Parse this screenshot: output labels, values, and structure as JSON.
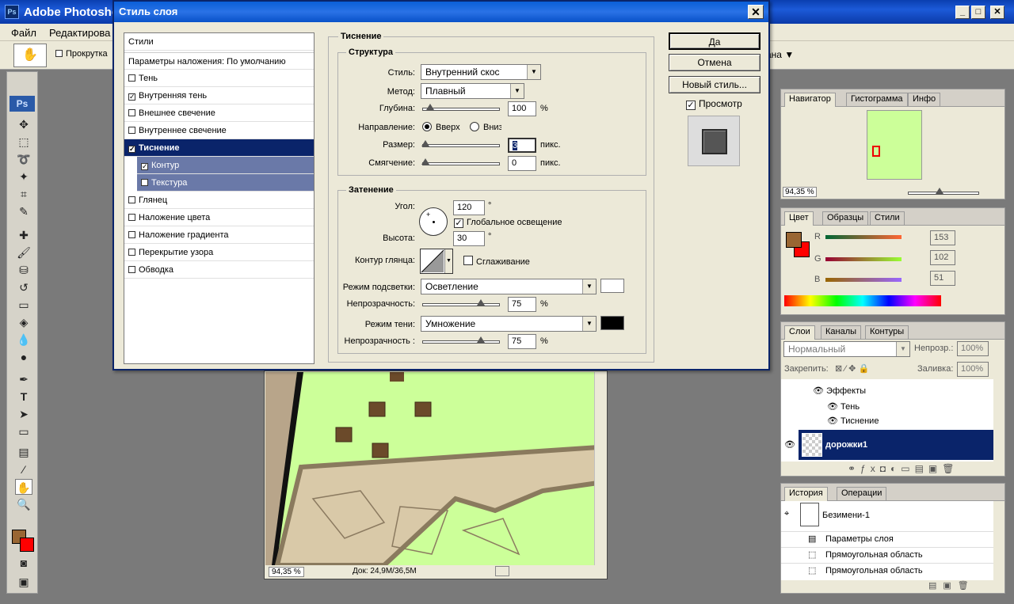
{
  "app": {
    "title": "Adobe Photosho",
    "logo": "Ps"
  },
  "menu": [
    "Файл",
    "Редактирова"
  ],
  "options": {
    "scroll_all": "Прокрутка",
    "dropdown_tail": "дана"
  },
  "document": {
    "zoom": "94,35 %",
    "doc_info": "Док: 24,9M/36,5M"
  },
  "navigator": {
    "tabs": [
      "Навигатор",
      "Гистограмма",
      "Инфо"
    ],
    "zoom": "94,35 %"
  },
  "color_panel": {
    "tabs": [
      "Цвет",
      "Образцы",
      "Стили"
    ],
    "r_label": "R",
    "g_label": "G",
    "b_label": "B",
    "r": "153",
    "g": "102",
    "b": "51",
    "foreground": "#996633",
    "background": "#ff0000"
  },
  "layers": {
    "tabs": [
      "Слои",
      "Каналы",
      "Контуры"
    ],
    "blend_mode": "Нормальный",
    "opacity_label": "Непрозр.:",
    "opacity": "100%",
    "lock_label": "Закрепить:",
    "fill_label": "Заливка:",
    "fill": "100%",
    "effects_label": "Эффекты",
    "effect_items": [
      "Тень",
      "Тиснение"
    ],
    "active_layer": "дорожки1"
  },
  "history": {
    "tabs": [
      "История",
      "Операции"
    ],
    "snapshot": "Безимени-1",
    "items": [
      "Параметры слоя",
      "Прямоугольная область",
      "Прямоугольная область"
    ]
  },
  "dialog": {
    "title": "Стиль слоя",
    "close_label": "✕",
    "styles_header": "Стили",
    "blend_options": "Параметры наложения: По умолчанию",
    "style_items": [
      {
        "label": "Тень",
        "checked": false
      },
      {
        "label": "Внутренняя тень",
        "checked": true
      },
      {
        "label": "Внешнее свечение",
        "checked": false
      },
      {
        "label": "Внутреннее свечение",
        "checked": false
      },
      {
        "label": "Тиснение",
        "checked": true
      },
      {
        "label": "Контур",
        "checked": true
      },
      {
        "label": "Текстура",
        "checked": false
      },
      {
        "label": "Глянец",
        "checked": false
      },
      {
        "label": "Наложение цвета",
        "checked": false
      },
      {
        "label": "Наложение градиента",
        "checked": false
      },
      {
        "label": "Перекрытие узора",
        "checked": false
      },
      {
        "label": "Обводка",
        "checked": false
      }
    ],
    "section_title": "Тиснение",
    "structure": {
      "title": "Структура",
      "style_label": "Стиль:",
      "style_value": "Внутренний скос",
      "method_label": "Метод:",
      "method_value": "Плавный",
      "depth_label": "Глубина:",
      "depth_value": "100",
      "depth_unit": "%",
      "direction_label": "Направление:",
      "dir_up": "Вверх",
      "dir_down": "Вниз",
      "size_label": "Размер:",
      "size_value": "3",
      "size_unit": "пикс.",
      "soften_label": "Смягчение:",
      "soften_value": "0",
      "soften_unit": "пикс."
    },
    "shading": {
      "title": "Затенение",
      "angle_label": "Угол:",
      "angle_value": "120",
      "deg": "°",
      "global_light": "Глобальное освещение",
      "altitude_label": "Высота:",
      "altitude_value": "30",
      "gloss_label": "Контур глянца:",
      "antialias": "Сглаживание",
      "highlight_label": "Режим подсветки:",
      "highlight_value": "Осветление",
      "hl_opacity_label": "Непрозрачность:",
      "hl_opacity": "75",
      "shadow_label": "Режим тени:",
      "shadow_value": "Умножение",
      "sh_opacity_label": "Непрозрачность :",
      "sh_opacity": "75",
      "percent": "%"
    },
    "buttons": {
      "ok": "Да",
      "cancel": "Отмена",
      "new_style": "Новый стиль..."
    },
    "preview_label": "Просмотр"
  }
}
